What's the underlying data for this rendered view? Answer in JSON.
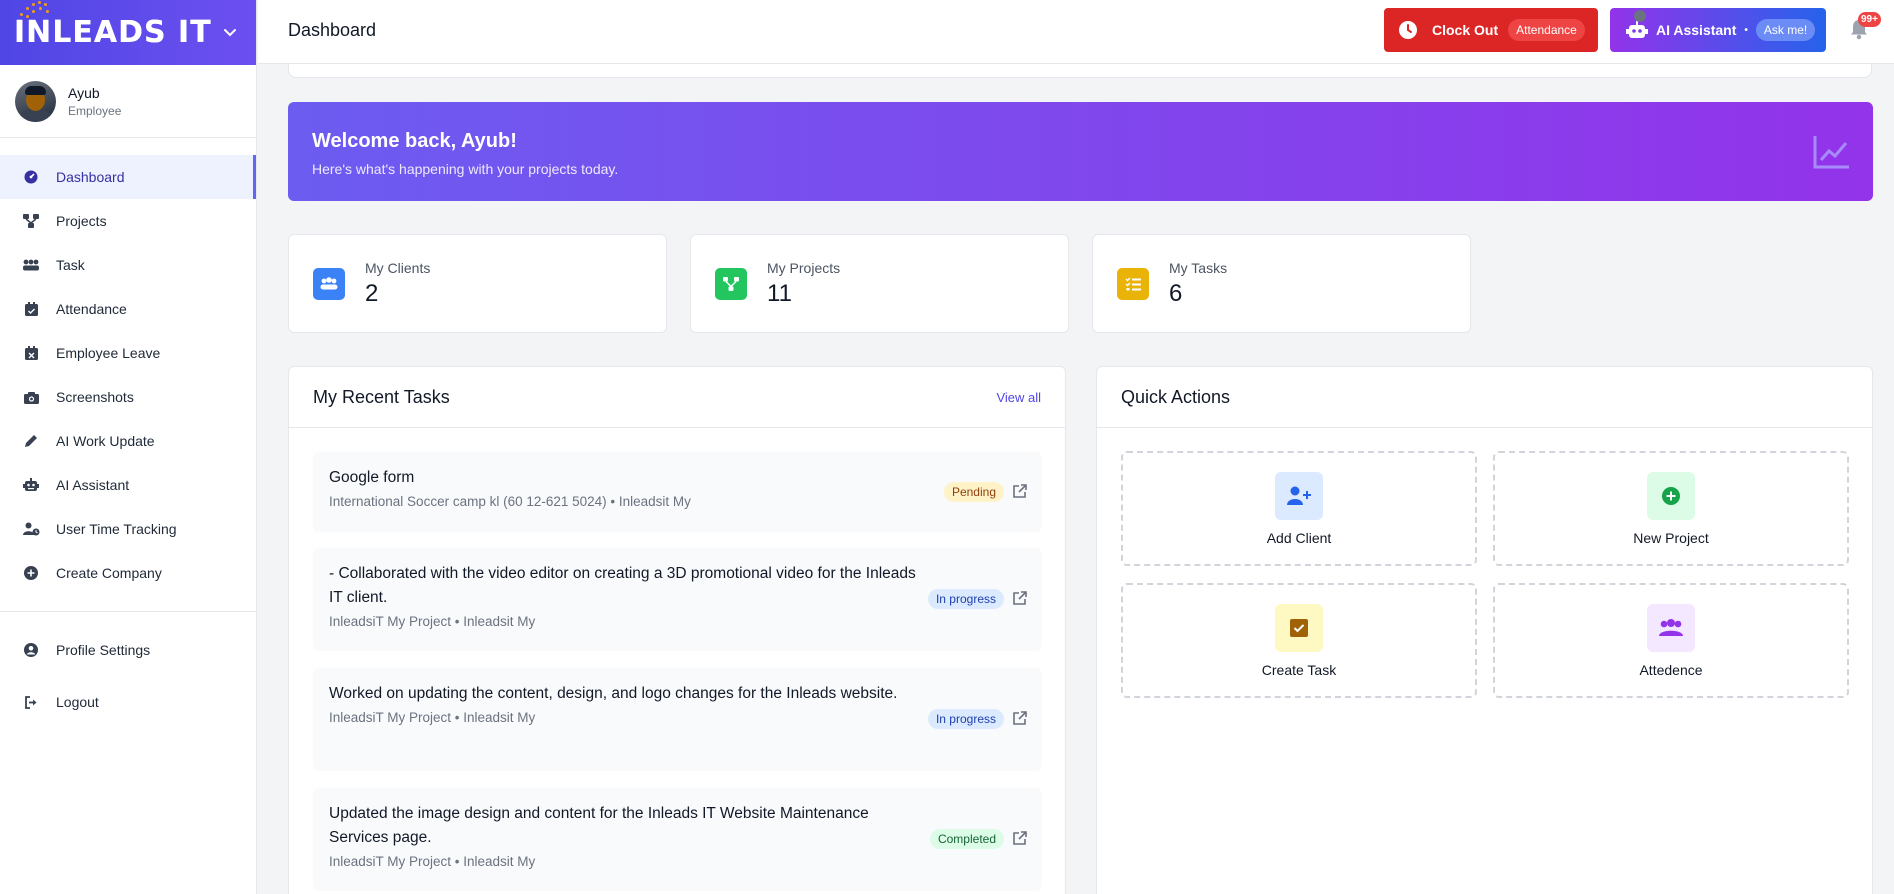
{
  "brand": {
    "logo_text": "INLEADS IT"
  },
  "user": {
    "name": "Ayub",
    "role": "Employee"
  },
  "sidebar": {
    "items": [
      {
        "label": "Dashboard",
        "icon": "gauge-icon",
        "active": true
      },
      {
        "label": "Projects",
        "icon": "diagram-icon"
      },
      {
        "label": "Task",
        "icon": "users-icon"
      },
      {
        "label": "Attendance",
        "icon": "calendar-check-icon"
      },
      {
        "label": "Employee Leave",
        "icon": "calendar-x-icon"
      },
      {
        "label": "Screenshots",
        "icon": "camera-icon"
      },
      {
        "label": "AI Work Update",
        "icon": "pencil-icon"
      },
      {
        "label": "AI Assistant",
        "icon": "robot-icon"
      },
      {
        "label": "User Time Tracking",
        "icon": "user-clock-icon"
      },
      {
        "label": "Create Company",
        "icon": "plus-circle-icon"
      }
    ],
    "bottom": [
      {
        "label": "Profile Settings",
        "icon": "user-circle-icon"
      },
      {
        "label": "Logout",
        "icon": "logout-icon"
      }
    ]
  },
  "header": {
    "title": "Dashboard",
    "clock_out_label": "Clock Out",
    "clock_out_pill": "Attendance",
    "ai_label": "AI Assistant",
    "ai_dot": "•",
    "ai_pill": "Ask me!",
    "notif_count": "99+"
  },
  "welcome": {
    "title": "Welcome back, Ayub!",
    "subtitle": "Here's what's happening with your projects today."
  },
  "stats": [
    {
      "label": "My Clients",
      "value": "2",
      "color": "#3b82f6"
    },
    {
      "label": "My Projects",
      "value": "11",
      "color": "#22c55e"
    },
    {
      "label": "My Tasks",
      "value": "6",
      "color": "#eab308"
    }
  ],
  "recent_tasks": {
    "title": "My Recent Tasks",
    "view_all": "View all",
    "items": [
      {
        "title": "Google form",
        "meta": "International Soccer camp kl (60 12-621 5024) • Inleadsit My",
        "status": "Pending"
      },
      {
        "title": "- Collaborated with the video editor on creating a 3D promotional video for the Inleads IT client.",
        "meta": "InleadsiT My Project • Inleadsit My",
        "status": "In progress"
      },
      {
        "title": "Worked on updating the content, design, and logo changes for the Inleads website.",
        "meta": "InleadsiT My Project • Inleadsit My",
        "status": "In progress"
      },
      {
        "title": "Updated the image design and content for the Inleads IT Website Maintenance Services page.",
        "meta": "InleadsiT My Project • Inleadsit My",
        "status": "Completed"
      }
    ]
  },
  "quick_actions": {
    "title": "Quick Actions",
    "items": [
      {
        "label": "Add Client",
        "icon": "user-plus-icon"
      },
      {
        "label": "New Project",
        "icon": "plus-circle-icon"
      },
      {
        "label": "Create Task",
        "icon": "checkbox-icon"
      },
      {
        "label": "Attedence",
        "icon": "users-icon"
      }
    ]
  }
}
